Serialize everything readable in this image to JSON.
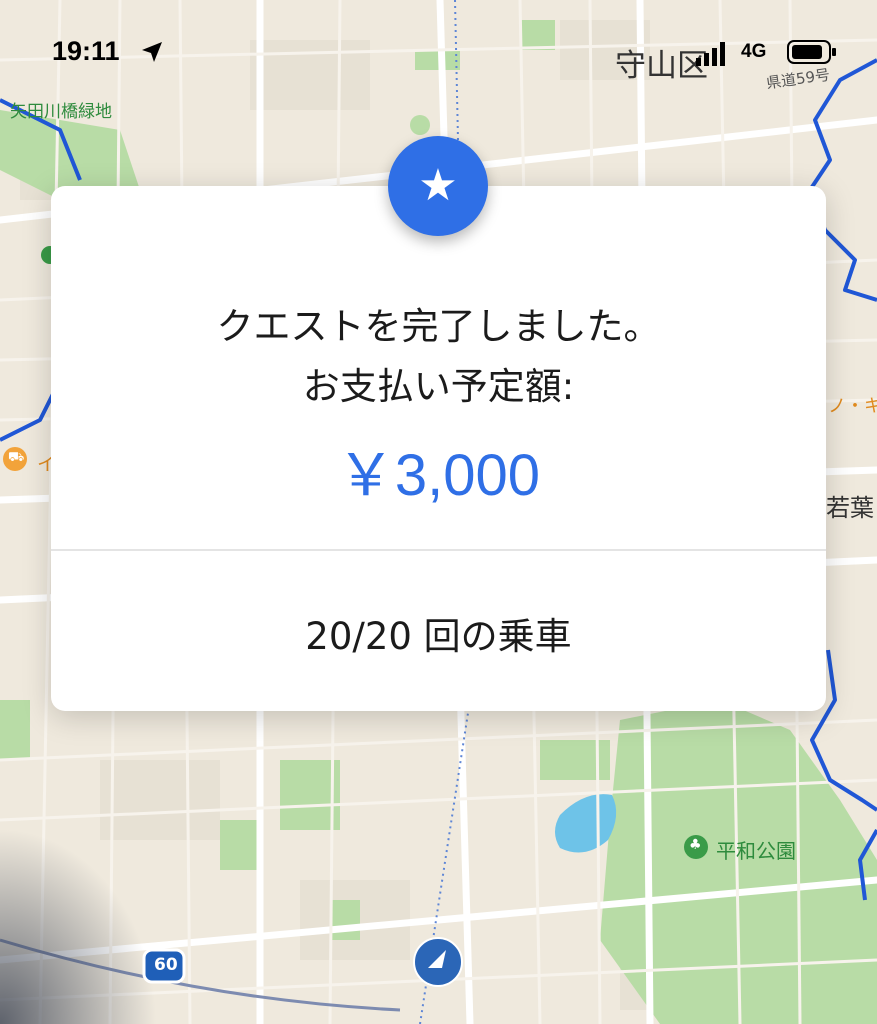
{
  "status_bar": {
    "time": "19:11",
    "network": "4G",
    "location_icon": "location-arrow-icon",
    "signal_icon": "cellular-signal-icon",
    "battery_icon": "battery-icon"
  },
  "map": {
    "labels": {
      "district": "守山区",
      "route_prefecture": "県道59号",
      "green_area": "矢田川橋緑地",
      "shop_partial": "イ",
      "area_right": "若葉",
      "orange_partial": "ノ・キ",
      "park": "平和公園",
      "route_number": "60"
    },
    "colors": {
      "background": "#efe9dd",
      "green": "#b8dca6",
      "water": "#6ec3e8",
      "boundary": "#2057d6",
      "route": "#4a7bd4"
    }
  },
  "modal": {
    "line1": "クエストを完了しました。",
    "line2": "お支払い予定額:",
    "amount": "￥3,000",
    "rides": "20/20 回の乗車",
    "badge_icon": "star-icon",
    "badge_glyph": "★",
    "accent": "#2f6fe6"
  }
}
